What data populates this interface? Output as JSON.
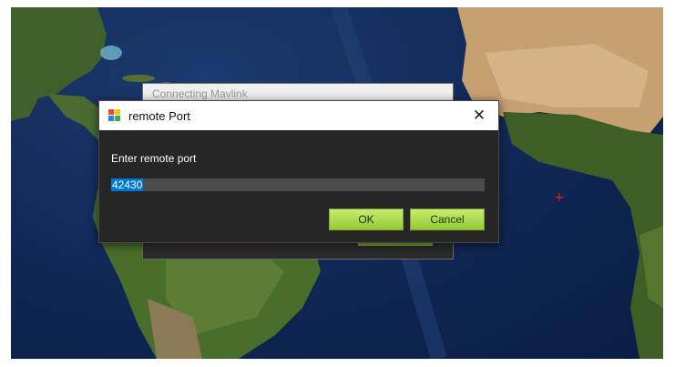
{
  "background_window": {
    "title": "Connecting Mavlink"
  },
  "dialog": {
    "title": "remote Port",
    "prompt": "Enter remote port",
    "port_value": "42430",
    "ok_label": "OK",
    "cancel_label": "Cancel",
    "close_glyph": "✕"
  },
  "map": {
    "marker_glyph": "+"
  },
  "colors": {
    "accent_button": "#9acd32",
    "dialog_bg": "#262626",
    "selection": "#0078d7"
  },
  "icons": [
    "app-icon",
    "close-icon",
    "crosshair-icon"
  ]
}
